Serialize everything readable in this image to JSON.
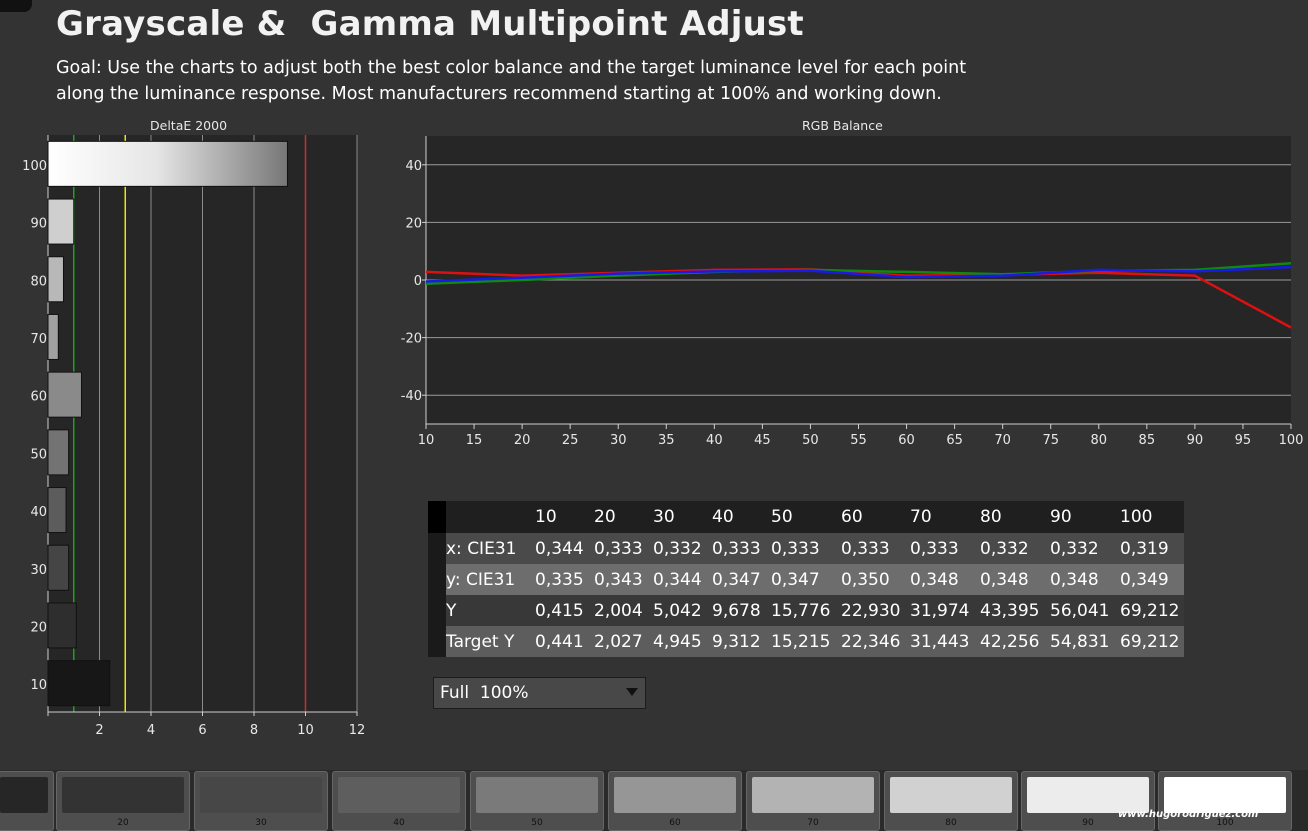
{
  "title": "Grayscale &  Gamma Multipoint Adjust",
  "goal_line1": "Goal: Use the charts to adjust both the best color balance and the target luminance level for each point",
  "goal_line2": "along the luminance response. Most manufacturers recommend starting at 100% and working down.",
  "chart_data": [
    {
      "type": "bar",
      "orientation": "horizontal",
      "title": "DeltaE 2000",
      "categories": [
        "100",
        "90",
        "80",
        "70",
        "60",
        "50",
        "40",
        "30",
        "20",
        "10"
      ],
      "values": [
        9.3,
        1.0,
        0.6,
        0.4,
        1.3,
        0.8,
        0.7,
        0.8,
        1.1,
        2.4
      ],
      "xticks": [
        "2",
        "4",
        "6",
        "8",
        "10",
        "12"
      ],
      "xlim": [
        0,
        12
      ],
      "reference_lines": [
        {
          "value": 1,
          "color": "#1fa01f"
        },
        {
          "value": 3,
          "color": "#e8e800"
        },
        {
          "value": 10,
          "color": "#d42a2a"
        }
      ],
      "grid": true
    },
    {
      "type": "line",
      "title": "RGB Balance",
      "x": [
        10,
        20,
        30,
        40,
        50,
        60,
        70,
        80,
        90,
        100
      ],
      "xticks": [
        "10",
        "15",
        "20",
        "25",
        "30",
        "35",
        "40",
        "45",
        "50",
        "55",
        "60",
        "65",
        "70",
        "75",
        "80",
        "85",
        "90",
        "95",
        "100"
      ],
      "yticks": [
        "40",
        "20",
        "0",
        "-20",
        "-40"
      ],
      "xlim": [
        10,
        100
      ],
      "ylim": [
        -50,
        50
      ],
      "series": [
        {
          "color": "#dd1111",
          "values": [
            2.8,
            1.5,
            2.5,
            3.5,
            3.7,
            1.5,
            1.8,
            2.5,
            1.5,
            -16.5
          ]
        },
        {
          "color": "#0f8a0f",
          "values": [
            -1.3,
            0.0,
            1.5,
            2.8,
            3.5,
            2.8,
            2.0,
            3.2,
            3.5,
            5.8
          ]
        },
        {
          "color": "#1a1ae6",
          "values": [
            -0.5,
            0.8,
            2.2,
            3.0,
            3.2,
            1.0,
            1.5,
            3.5,
            3.0,
            4.5
          ]
        }
      ],
      "grid": true
    }
  ],
  "table": {
    "columns": [
      "10",
      "20",
      "30",
      "40",
      "50",
      "60",
      "70",
      "80",
      "90",
      "100"
    ],
    "rows": [
      {
        "label": "x: CIE31",
        "values": [
          "0,344",
          "0,333",
          "0,332",
          "0,333",
          "0,333",
          "0,333",
          "0,333",
          "0,332",
          "0,332",
          "0,319"
        ]
      },
      {
        "label": "y: CIE31",
        "values": [
          "0,335",
          "0,343",
          "0,344",
          "0,347",
          "0,347",
          "0,350",
          "0,348",
          "0,348",
          "0,348",
          "0,349"
        ]
      },
      {
        "label": "Y",
        "values": [
          "0,415",
          "2,004",
          "5,042",
          "9,678",
          "15,776",
          "22,930",
          "31,974",
          "43,395",
          "56,041",
          "69,212"
        ]
      },
      {
        "label": "Target Y",
        "values": [
          "0,441",
          "2,027",
          "4,945",
          "9,312",
          "15,215",
          "22,346",
          "31,443",
          "42,256",
          "54,831",
          "69,212"
        ]
      }
    ]
  },
  "dropdown": {
    "value": "Full  100%"
  },
  "patches": [
    {
      "label": "",
      "color": "#262626"
    },
    {
      "label": "20",
      "color": "#333333"
    },
    {
      "label": "30",
      "color": "#474747"
    },
    {
      "label": "40",
      "color": "#5e5e5e"
    },
    {
      "label": "50",
      "color": "#7a7a7a"
    },
    {
      "label": "60",
      "color": "#969696"
    },
    {
      "label": "70",
      "color": "#b3b3b3"
    },
    {
      "label": "80",
      "color": "#d1d1d1"
    },
    {
      "label": "90",
      "color": "#ececec"
    },
    {
      "label": "100",
      "color": "#ffffff"
    }
  ],
  "watermark": "www.hugorodriguez.com"
}
